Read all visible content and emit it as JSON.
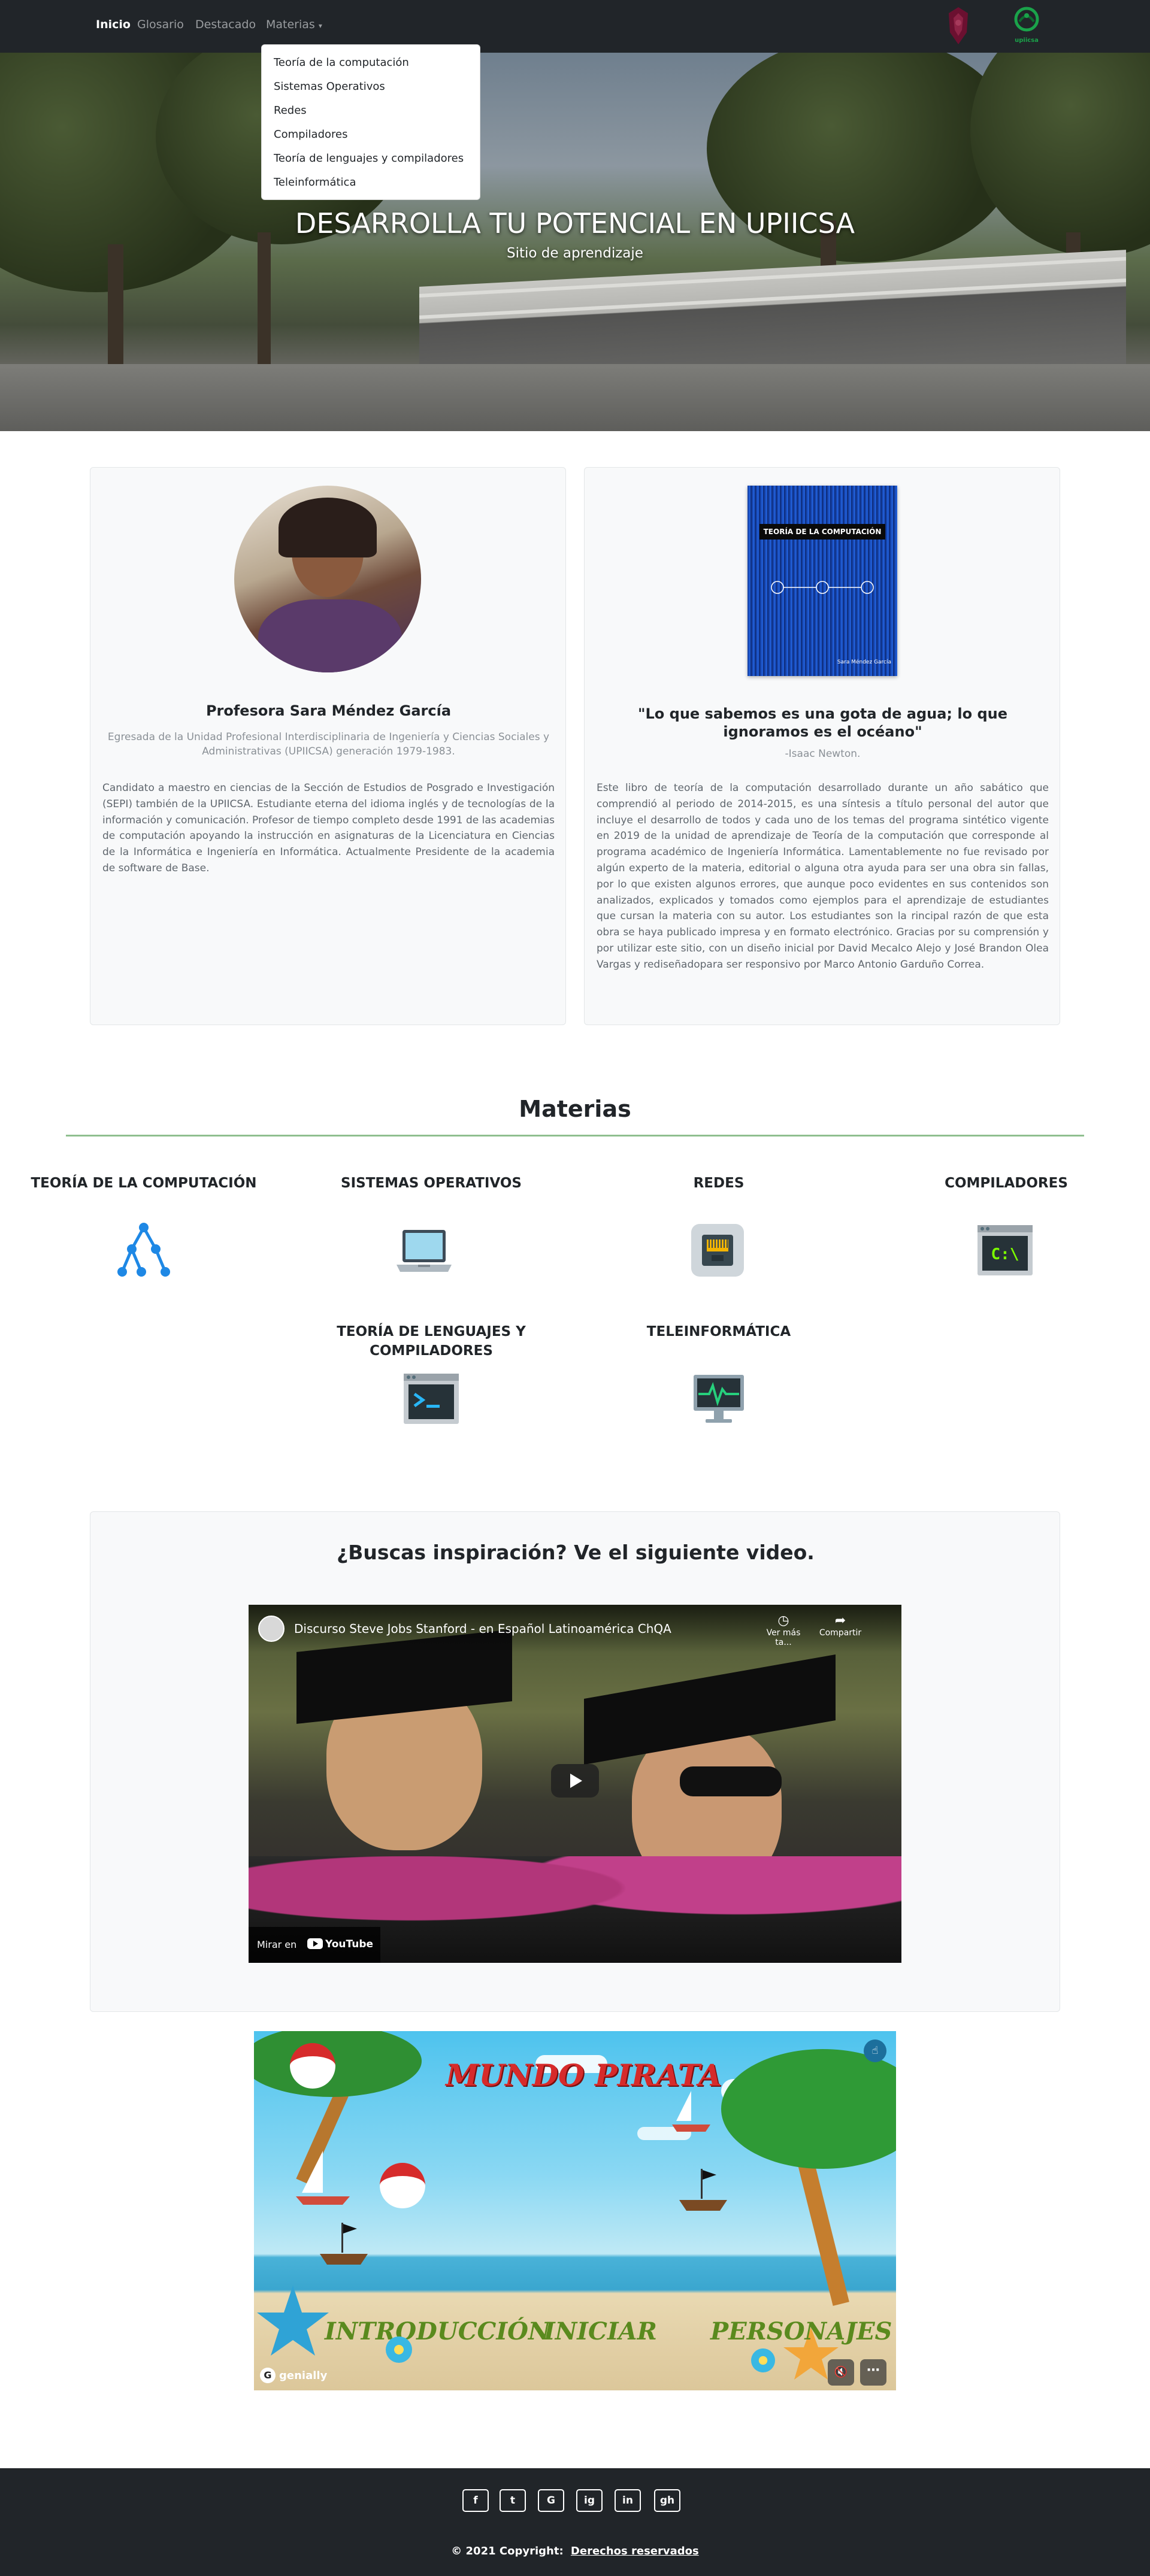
{
  "navbar": {
    "links": [
      {
        "label": "Inicio",
        "active": true
      },
      {
        "label": "Glosario",
        "active": false
      },
      {
        "label": "Destacado",
        "active": false
      },
      {
        "label": "Materias",
        "active": false
      }
    ],
    "dropdown_items": [
      "Teoría de la computación",
      "Sistemas Operativos",
      "Redes",
      "Compiladores",
      "Teoría de lenguajes y compiladores",
      "Teleinformática"
    ],
    "logo_right_text": "upiicsa"
  },
  "hero": {
    "title": "DESARROLLA TU POTENCIAL EN UPIICSA",
    "subtitle": "Sitio de aprendizaje"
  },
  "profile_card": {
    "name": "Profesora Sara Méndez García",
    "subtitle": "Egresada de la Unidad Profesional Interdisciplinaria de Ingeniería y Ciencias Sociales y Administrativas (UPIICSA) generación 1979-1983.",
    "bio": "Candidato a maestro en ciencias de la Sección de Estudios de Posgrado e Investigación (SEPI) también de la UPIICSA. Estudiante eterna del idioma inglés y de tecnologías de la información y comunicación. Profesor de tiempo completo desde 1991 de las academias de computación apoyando la instrucción en asignaturas de la Licenciatura en Ciencias de la Informática e Ingeniería en Informática. Actualmente Presidente de la academia de software de Base."
  },
  "book_card": {
    "cover_title": "TEORÍA DE LA COMPUTACIÓN",
    "cover_author": "Sara Méndez García",
    "quote": "\"Lo que sabemos es una gota de agua; lo que ignoramos es el océano\"",
    "quote_author": "-Isaac Newton.",
    "description": "Este libro de teoría de la computación desarrollado durante un año sabático que comprendió al periodo de 2014-2015, es una síntesis a título personal del autor que incluye el desarrollo de todos y cada uno de los temas del programa sintético vigente en 2019 de la unidad de aprendizaje de Teoría de la computación que corresponde al programa académico de Ingeniería Informática. Lamentablemente no fue revisado por algún experto de la materia, editorial o alguna otra ayuda para ser una obra sin fallas, por lo que existen algunos errores, que aunque poco evidentes en sus contenidos son analizados, explicados y tomados como ejemplos para el aprendizaje de estudiantes que cursan la materia con su autor. Los estudiantes son la rincipal razón de que esta obra se haya publicado impresa y en formato electrónico. Gracias por su comprensión y por utilizar este sitio, con un diseño inicial por David Mecalco Alejo y José Brandon Olea Vargas y rediseñadopara ser responsivo por Marco Antonio Garduño Correa."
  },
  "materias": {
    "heading": "Materias",
    "accent": "#8fbf8f",
    "items": [
      {
        "title": "TEORÍA DE LA COMPUTACIÓN",
        "icon": "tree-graph-icon"
      },
      {
        "title": "SISTEMAS OPERATIVOS",
        "icon": "laptop-icon"
      },
      {
        "title": "REDES",
        "icon": "ethernet-port-icon"
      },
      {
        "title": "COMPILADORES",
        "icon": "command-prompt-icon"
      },
      {
        "title": "TEORÍA DE LENGUAJES Y COMPILADORES",
        "icon": "terminal-icon"
      },
      {
        "title": "TELEINFORMÁTICA",
        "icon": "monitor-pulse-icon"
      }
    ]
  },
  "video_section": {
    "heading": "¿Buscas inspiración? Ve el siguiente video.",
    "video_title": "Discurso Steve Jobs Stanford - en Español Latinoamérica ChQA",
    "watch_later": "Ver más ta...",
    "share": "Compartir",
    "watch_on": "Mirar en",
    "youtube": "YouTube"
  },
  "genially": {
    "title": "MUNDO PIRATA",
    "links": [
      "INTRODUCCIÓN",
      "INICIAR",
      "PERSONAJES"
    ],
    "brand": "genially"
  },
  "footer": {
    "social": [
      "f",
      "t",
      "G",
      "ig",
      "in",
      "gh"
    ],
    "copyright": "© 2021 Copyright:",
    "rights_link": "Derechos reservados"
  },
  "colors": {
    "navbar": "#212529",
    "card_bg": "#f8f9fa",
    "icon_blue": "#1e88e5"
  }
}
